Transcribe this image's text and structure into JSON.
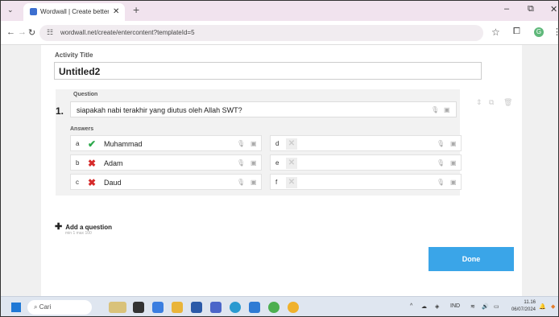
{
  "browser": {
    "tab_menu_icon": "chevron-down-icon",
    "tab_title": "Wordwall | Create better lesson",
    "tab_close": "✕",
    "new_tab": "+",
    "window_controls": [
      "–",
      "⧉",
      "✕"
    ],
    "url": "wordwall.net/create/entercontent?templateId=5"
  },
  "editor": {
    "activity_title_label": "Activity Title",
    "activity_title_value": "Untitled2",
    "question_label": "Question",
    "question_number": "1.",
    "question_text": "siapakah nabi terakhir yang diutus oleh Allah SWT?",
    "answers_label": "Answers",
    "answers": [
      {
        "letter": "a",
        "status": "correct",
        "text": "Muhammad"
      },
      {
        "letter": "b",
        "status": "wrong",
        "text": "Adam"
      },
      {
        "letter": "c",
        "status": "wrong",
        "text": "Daud"
      },
      {
        "letter": "d",
        "status": "empty",
        "text": ""
      },
      {
        "letter": "e",
        "status": "empty",
        "text": ""
      },
      {
        "letter": "f",
        "status": "empty",
        "text": ""
      }
    ],
    "add_question_label": "Add a question",
    "add_question_hint": "min 1  max 100",
    "done_label": "Done"
  },
  "taskbar": {
    "search_placeholder": "Cari",
    "language": "IND",
    "time": "11.16",
    "date": "06/07/2024"
  },
  "colors": {
    "done_button": "#3aa5e8",
    "correct": "#2aa84a",
    "wrong": "#d62a2a",
    "tab_strip": "#f1e3ee"
  }
}
